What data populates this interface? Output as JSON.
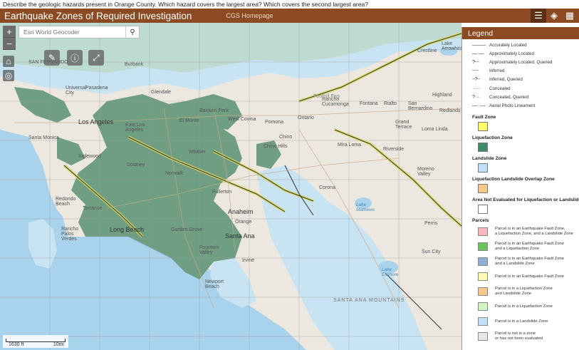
{
  "question": "Describe the geologic hazards present in Orange County. Which hazard covers the largest area? Which covers the second largest area?",
  "header": {
    "title": "Earthquake Zones of Required Investigation",
    "home_link": "CGS Homepage",
    "tools": [
      "list-icon",
      "layers-icon",
      "basemap-gallery-icon"
    ]
  },
  "search": {
    "placeholder": "Esri World Geocoder"
  },
  "scalebar": {
    "left_label": "1630 ft",
    "right_label": "10mi"
  },
  "map_labels": {
    "los_angeles": "Los Angeles",
    "anaheim": "Anaheim",
    "long_beach": "Long Beach",
    "santa_ana": "Santa Ana",
    "pomona": "Pomona",
    "ontario": "Ontario",
    "rancho": "Rancho\nCucamonga",
    "fontana": "Fontana",
    "san_bernardino": "San\nBernardino",
    "riverside": "Riverside",
    "corona": "Corona",
    "irvine": "Irvine",
    "downey": "Downey",
    "norwalk": "Norwalk",
    "fullerton": "Fullerton",
    "garden_grove": "Garden Grove",
    "torrance": "Torrance",
    "santa_monica": "Santa Monica",
    "inglewood": "Inglewood",
    "pasadena": "Pasadena",
    "burbank": "Burbank",
    "el_monte": "El Monte",
    "baldwin_park": "Baldwin Park",
    "west_covina": "West Covina",
    "chino": "Chino",
    "chino_hills": "Chino Hills",
    "mira_loma": "Mira Loma",
    "moreno_valley": "Moreno\nValley",
    "perris": "Perris",
    "sun_city": "Sun City",
    "lake_elsinore": "Lake\nElsinore",
    "lake_mathews": "Lake\nMathews",
    "newport": "Newport\nBeach",
    "fountain_valley": "Fountain\nValley",
    "orange": "Orange",
    "redondo": "Redondo\nBeach",
    "rancho_palos": "Rancho\nPalos\nVerdes",
    "grand_terrace": "Grand\nTerrace",
    "loma_linda": "Loma Linda",
    "redlands": "Redlands",
    "santa_ana_mountains": "SANTA ANA MOUNTAINS",
    "highland": "Highland",
    "crestline": "Crestline",
    "lake_arrowhead": "Lake\nArrowhead",
    "san_fernando": "SAN FERNANDO",
    "universal": "Universal\nCity",
    "glendale": "Glendale",
    "downey2": "Whittier",
    "east_la": "East Los\nAngeles",
    "foothill": "Foothill Fwy",
    "rialto": "Rialto"
  },
  "legend": {
    "title": "Legend",
    "fault_lines": [
      {
        "symbol": "———",
        "label": "Accurately Located"
      },
      {
        "symbol": "— · —",
        "label": "Approximately Located"
      },
      {
        "symbol": "?- - -",
        "label": "Approximately Located, Queried"
      },
      {
        "symbol": "- - - -",
        "label": "Inferred"
      },
      {
        "symbol": "- -?- -",
        "label": "Inferred, Queried"
      },
      {
        "symbol": "· · · · ·",
        "label": "Concealed"
      },
      {
        "symbol": "?· · · ·",
        "label": "Concealed, Queried"
      },
      {
        "symbol": "— · · —",
        "label": "Aerial Photo Lineament"
      }
    ],
    "zones": [
      {
        "label": "Fault Zone",
        "color": "#fefe6a"
      },
      {
        "label": "Liquefaction Zone",
        "color": "#3f8a6a"
      },
      {
        "label": "Landslide Zone",
        "color": "#bfe1f7"
      },
      {
        "label": "Liquefaction Landslide Overlap Zone",
        "color": "#f6c98a"
      },
      {
        "label": "Area Not Evaluated for Liquefaction or Landslides",
        "color": "#ffffff"
      }
    ],
    "parcels_title": "Parcels",
    "parcels": [
      {
        "label": "Parcel is in an Earthquake Fault Zone,\na Liquefaction Zone, and a Landslide Zone",
        "color": "#f7b9bd"
      },
      {
        "label": "Parcel is in an Earthquake Fault Zone\nand a Liquefaction Zone",
        "color": "#6cc35e"
      },
      {
        "label": "Parcel is in an Earthquake Fault Zone\nand a Landslide Zone",
        "color": "#90afd3"
      },
      {
        "label": "Parcel is in an Earthquake Fault Zone",
        "color": "#fefeb0"
      },
      {
        "label": "Parcel is in a Liquefaction Zone\nand Landslide Zone",
        "color": "#f7c68a"
      },
      {
        "label": "Parcel is in a Liquefaction Zone",
        "color": "#d3f5c4"
      },
      {
        "label": "Parcel is in a Landslide Zone",
        "color": "#bfe0f5"
      },
      {
        "label": "Parcel is not in a zone\nor has not been evaluated",
        "color": "#e8e8e8"
      }
    ]
  }
}
